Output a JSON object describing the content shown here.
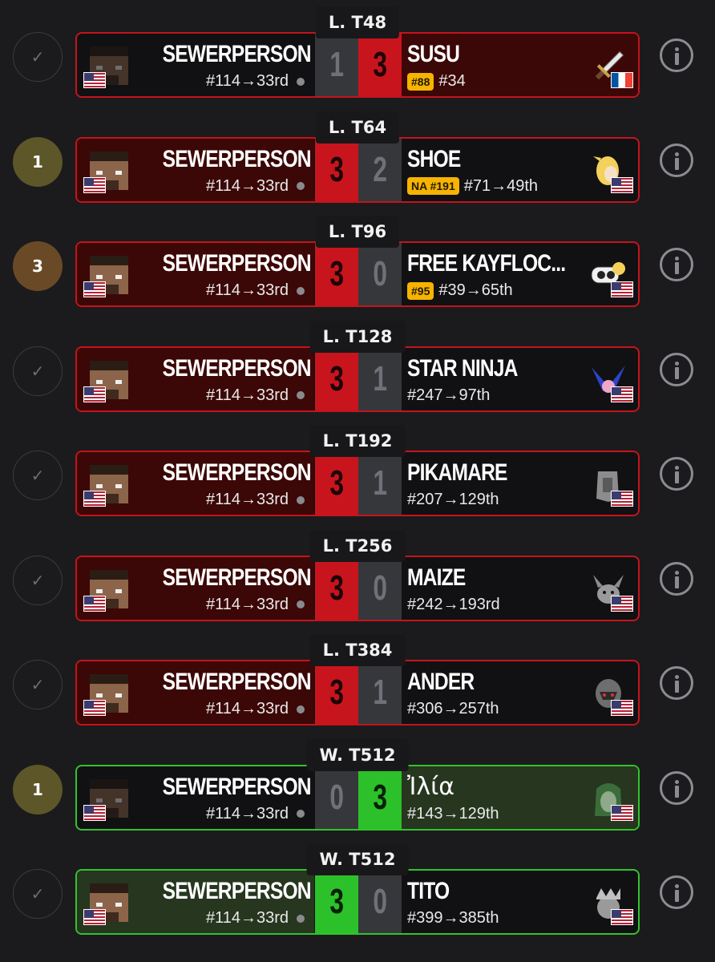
{
  "player": {
    "name": "SEWERPERSON",
    "rank_change": "#114→33rd"
  },
  "colors": {
    "loss_border": "#c4141b",
    "win_border": "#33c22e",
    "badge": "#f6b300"
  },
  "matches": [
    {
      "round": "L. T48",
      "result": "loss",
      "status": "check",
      "status_text": "✓",
      "score_left": "1",
      "score_right": "3",
      "winner": "right",
      "opponent": "SUSU",
      "opp_badge": "#88",
      "opp_info": "#34",
      "opp_flag": "france",
      "opp_icon": "sword-icon"
    },
    {
      "round": "L. T64",
      "result": "loss",
      "status": "number",
      "status_text": "1",
      "score_left": "3",
      "score_right": "2",
      "winner": "left",
      "opponent": "SHOE",
      "opp_badge": "NA #191",
      "opp_info": "#71→49th",
      "opp_flag": "usa",
      "opp_icon": "blonde-character-icon"
    },
    {
      "round": "L. T96",
      "result": "loss",
      "status": "number",
      "status_text": "3",
      "score_left": "3",
      "score_right": "0",
      "winner": "left",
      "opponent": "FREE KAYFLOC...",
      "opp_badge": "#95",
      "opp_info": "#39→65th",
      "opp_flag": "usa",
      "opp_icon": "robot-character-icon"
    },
    {
      "round": "L. T128",
      "result": "loss",
      "status": "check",
      "status_text": "✓",
      "score_left": "3",
      "score_right": "1",
      "winner": "left",
      "opponent": "STAR NINJA",
      "opp_badge": "",
      "opp_info": "#247→97th",
      "opp_flag": "usa",
      "opp_icon": "star-character-icon"
    },
    {
      "round": "L. T192",
      "result": "loss",
      "status": "check",
      "status_text": "✓",
      "score_left": "3",
      "score_right": "1",
      "winner": "left",
      "opponent": "PIKAMARE",
      "opp_badge": "",
      "opp_info": "#207→129th",
      "opp_flag": "usa",
      "opp_icon": "knight-character-icon"
    },
    {
      "round": "L. T256",
      "result": "loss",
      "status": "check",
      "status_text": "✓",
      "score_left": "3",
      "score_right": "0",
      "winner": "left",
      "opponent": "MAIZE",
      "opp_badge": "",
      "opp_info": "#242→193rd",
      "opp_flag": "usa",
      "opp_icon": "mouse-character-icon"
    },
    {
      "round": "L. T384",
      "result": "loss",
      "status": "check",
      "status_text": "✓",
      "score_left": "3",
      "score_right": "1",
      "winner": "left",
      "opponent": "ANDER",
      "opp_badge": "",
      "opp_info": "#306→257th",
      "opp_flag": "usa",
      "opp_icon": "helmet-character-icon"
    },
    {
      "round": "W. T512",
      "result": "win",
      "status": "number",
      "status_text": "1",
      "score_left": "0",
      "score_right": "3",
      "winner": "right",
      "opponent": "Ἰλία",
      "opp_badge": "",
      "opp_info": "#143→129th",
      "opp_flag": "usa",
      "opp_icon": "green-character-icon"
    },
    {
      "round": "W. T512",
      "result": "win",
      "status": "check",
      "status_text": "✓",
      "score_left": "3",
      "score_right": "0",
      "winner": "left",
      "opponent": "TITO",
      "opp_badge": "",
      "opp_info": "#399→385th",
      "opp_flag": "usa",
      "opp_icon": "crown-character-icon"
    }
  ]
}
